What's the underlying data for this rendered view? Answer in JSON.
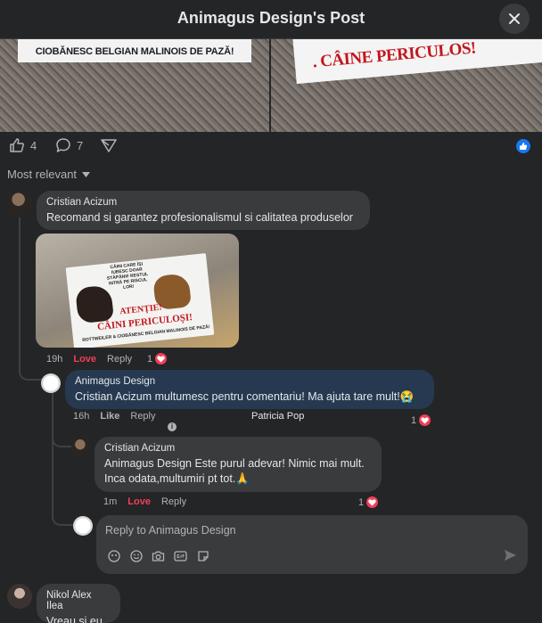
{
  "header": {
    "title": "Animagus Design's Post"
  },
  "post": {
    "photo_left_sign": "CIOBĂNESC BELGIAN MALINOIS DE PAZĂ!",
    "photo_right_sign": ". CÂINE PERICULOS!",
    "like_count": "4",
    "comment_count": "7"
  },
  "sort": {
    "label": "Most relevant"
  },
  "comments": [
    {
      "author": "Cristian Acizum",
      "text": "Recomand si garantez profesionalismul si calitatea produselor",
      "image_sign": {
        "top": "CÂINI CARE ÎȘI IUBESC DOAR STĂPÂNII! RESTUL INTRĂ PE RISCUL LOR!",
        "warning": "ATENȚIE!",
        "danger": "CÂINI PERICULOȘI!",
        "bottom": "ROTTWEILER & CIOBĂNESC BELGIAN MALINOIS DE PAZĂ!"
      },
      "time": "19h",
      "reaction_label": "Love",
      "reply_label": "Reply",
      "reaction_count": "1"
    },
    {
      "author": "Animagus Design",
      "text": "Cristian Acizum multumesc pentru comentariu! Ma ajuta tare mult!😭",
      "time": "16h",
      "reaction_label": "Like",
      "reply_label": "Reply",
      "seen_by": "Patricia Pop",
      "reaction_count": "1",
      "accent": "#263951"
    },
    {
      "author": "Cristian Acizum",
      "text_line1": "Animagus Design Este purul adevar! Nimic mai mult.",
      "text_line2": "Inca odata,multumiri pt tot.🙏",
      "time": "1m",
      "reaction_label": "Love",
      "reply_label": "Reply",
      "reaction_count": "1"
    },
    {
      "author": "Nikol Alex Ilea",
      "text": "Vreau si eu"
    }
  ],
  "reply_box": {
    "placeholder": "Reply to Animagus Design"
  },
  "colors": {
    "background": "#242526",
    "bubble": "#3a3b3c",
    "love": "#f33e58",
    "like_blue": "#1877f2"
  }
}
